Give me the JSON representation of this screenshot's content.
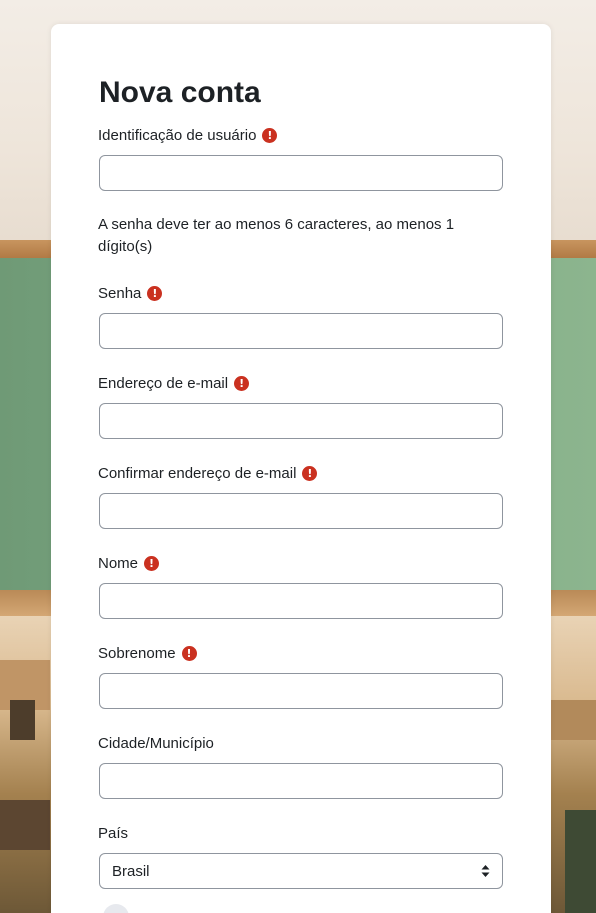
{
  "form": {
    "title": "Nova conta",
    "password_hint": "A senha deve ter ao menos 6 caracteres, ao menos 1 dígito(s)",
    "fields": {
      "username": {
        "label": "Identificação de usuário",
        "required": true,
        "value": ""
      },
      "password": {
        "label": "Senha",
        "required": true,
        "value": ""
      },
      "email": {
        "label": "Endereço de e-mail",
        "required": true,
        "value": ""
      },
      "email_confirm": {
        "label": "Confirmar endereço de e-mail",
        "required": true,
        "value": ""
      },
      "first_name": {
        "label": "Nome",
        "required": true,
        "value": ""
      },
      "last_name": {
        "label": "Sobrenome",
        "required": true,
        "value": ""
      },
      "city": {
        "label": "Cidade/Município",
        "required": false,
        "value": ""
      },
      "country": {
        "label": "País",
        "required": false,
        "selected": "Brasil"
      }
    },
    "required_icon": "exclamation-circle-icon",
    "required_color": "#ca3120"
  }
}
